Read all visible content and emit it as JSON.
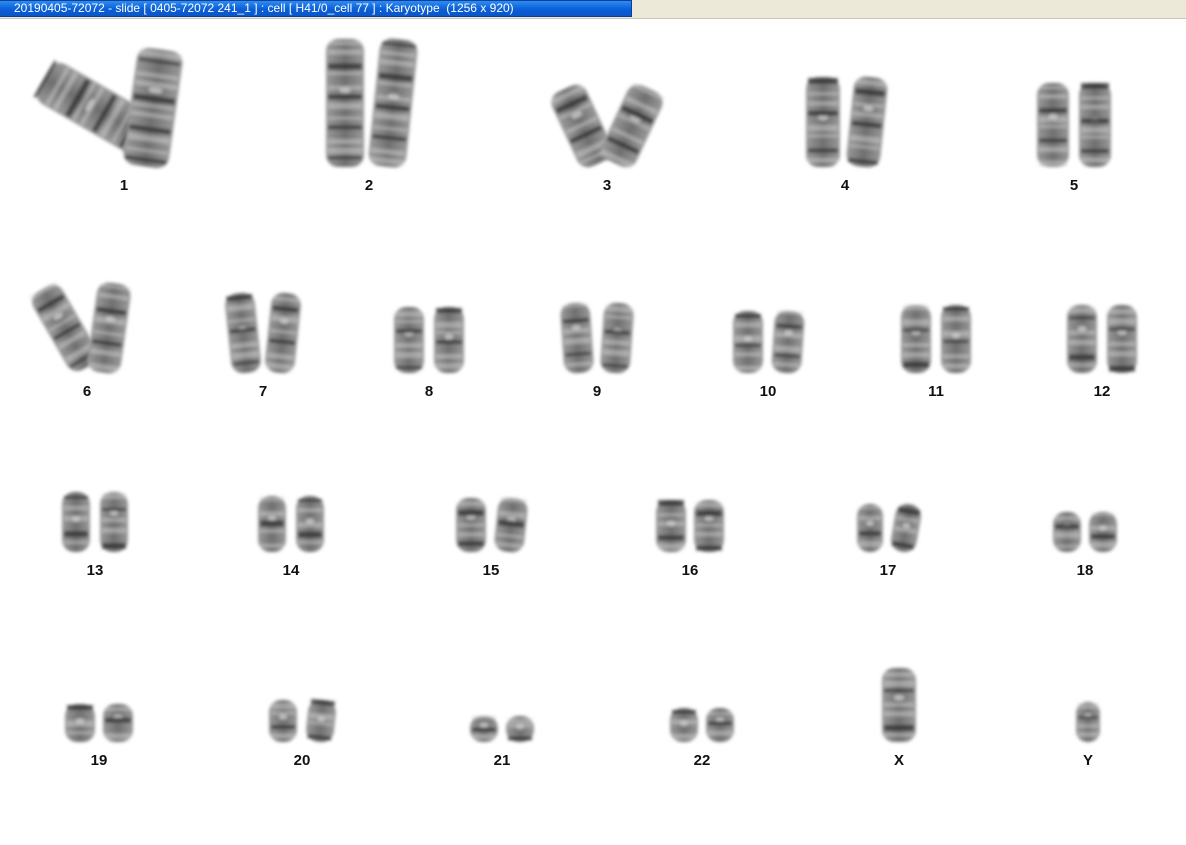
{
  "window": {
    "title": "20190405-72072 - slide [ 0405-72072 241_1 ] : cell [ H41/0_cell 77 ] : Karyotype  (1256 x 920)"
  },
  "karyotype": {
    "chromosomes": [
      "1",
      "2",
      "3",
      "4",
      "5",
      "6",
      "7",
      "8",
      "9",
      "10",
      "11",
      "12",
      "13",
      "14",
      "15",
      "16",
      "17",
      "18",
      "19",
      "20",
      "21",
      "22",
      "X",
      "Y"
    ]
  }
}
